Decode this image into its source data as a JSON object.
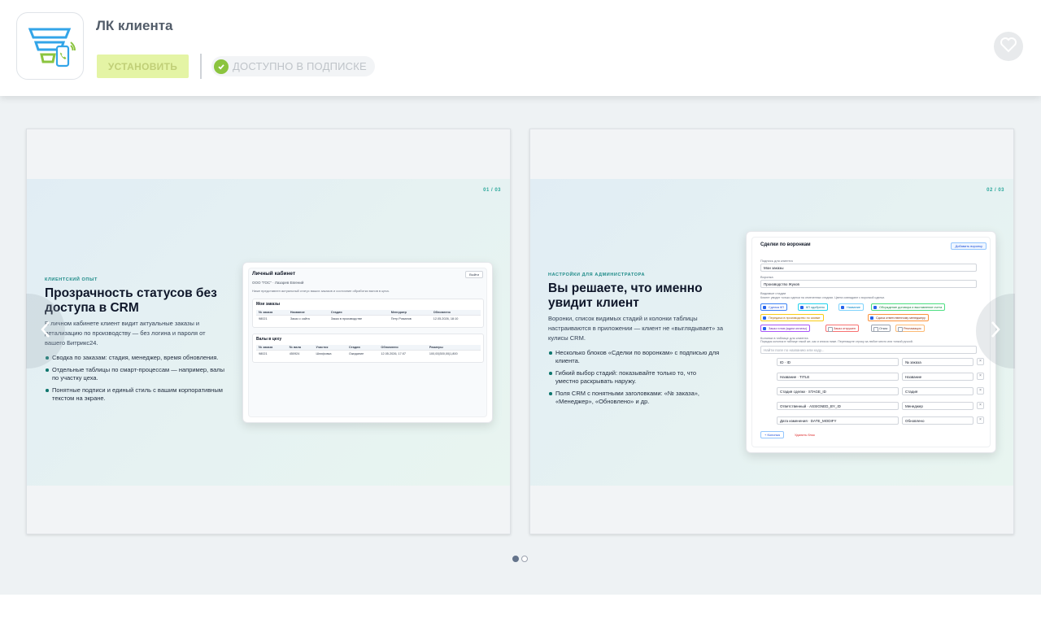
{
  "app": {
    "title": "ЛК клиента",
    "install_label": "УСТАНОВИТЬ",
    "subscription_label": "ДОСТУПНО В ПОДПИСКЕ",
    "logo_icon": "funnel-phone-icon",
    "favorite_icon": "heart-icon"
  },
  "colors": {
    "accent_green": "#8bc43f",
    "install_bg": "#e4f4a5",
    "teal": "#2aa79b"
  },
  "slides": [
    {
      "counter": "01 / 03",
      "eyebrow": "КЛИЕНТСКИЙ ОПЫТ",
      "heading_1": "Прозрачность статусов без",
      "heading_2": "доступа в CRM",
      "desc_1": "В личном кабинете клиент видит актуальные заказы и",
      "desc_2": "детализацию по производству — без логина и пароля от",
      "desc_3": "вашего Битрикс24.",
      "bullets": [
        "Сводка по заказам: стадия, менеджер, время обновления.",
        "Отдельные таблицы по смарт-процессам — например, валы по участку цеха.",
        "Понятные подписи и единый стиль с вашим корпоративным текстом на экране."
      ],
      "mock": {
        "title": "Личный кабинет",
        "exit": "Выйти",
        "company": "ООО \"ГОС\" · Лазарев Евгений",
        "note": "Ниже представлен актуальный статус ваших заказов и состояние обработки валов в цеха.",
        "orders_title": "Мои заказы",
        "orders_headers": [
          "№ заказа",
          "Название",
          "Стадия",
          "Менеджер",
          "Обновлено"
        ],
        "orders_rows": [
          [
            "98021",
            "Заказ с сайта",
            "Заказ в производстве",
            "Петр Романов",
            "12.05.2026, 18:10"
          ]
        ],
        "shafts_title": "Валы в цеху",
        "shafts_headers": [
          "№ заказа",
          "№ вала",
          "Участок",
          "Стадия",
          "Обновлено",
          "Размеры"
        ],
        "shafts_rows": [
          [
            "98021",
            "450924",
            "Шлифовка",
            "Ожидание",
            "12.05.2026, 17:07",
            "100,00|300,00|1,800"
          ]
        ]
      }
    },
    {
      "counter": "02 / 03",
      "eyebrow": "НАСТРОЙКИ ДЛЯ АДМИНИСТРАТОРА",
      "heading_1": "Вы решаете, что именно",
      "heading_2": "увидит клиент",
      "desc_1": "Воронки, список видимых стадий и колонки таблицы",
      "desc_2": "настраиваются в приложении — клиент не «выглядывает» за",
      "desc_3": "кулисы CRM.",
      "bullets": [
        "Несколько блоков «Сделки по воронкам» с подписью для клиента.",
        "Гибкий выбор стадий: показывайте только то, что уместно раскрывать наружу.",
        "Поля CRM с понятными заголовками: «№ заказа», «Менеджер», «Обновлено» и др."
      ],
      "mock": {
        "title": "Сделки по воронкам",
        "add_btn": "Добавить воронку",
        "caption_label": "Подпись для клиента",
        "caption_value": "Мои заказы",
        "funnel_label": "Воронка",
        "funnel_value": "Производство Жуков",
        "stages_label": "Видимые стадии",
        "stages_note": "Клиент увидит только сделки на отмеченных стадиях. Цвета совпадают с воронкой сделки.",
        "chips": [
          "Сделка КП",
          "КП одобрено",
          "Название",
          "Обсуждение договора и выставление счета",
          "Передача в производство по заявке",
          "Сдача ответственному менеджеру",
          "Заказ готов (ждем оплаты)",
          "Заказ отгружен",
          "Отказ",
          "Рекламация"
        ],
        "columns_label": "Колонки в таблице для клиента",
        "columns_note": "Порядок колонок в таблице такой же, как и список ниже. Перетащите строку за любое место или тонкой ручкой.",
        "search_placeholder": "Найти поле по названию или коду...",
        "rows": [
          [
            "ID · ID",
            "№ заказа"
          ],
          [
            "Название · TITLE",
            "Название"
          ],
          [
            "Стадия сделки · STAGE_ID",
            "Стадия"
          ],
          [
            "Ответственный · ASSIGNED_BY_ID",
            "Менеджер"
          ],
          [
            "Дата изменения · DATE_MODIFY",
            "Обновлено"
          ]
        ],
        "add_column": "+ Колонка",
        "delete_block": "Удалить блок"
      }
    }
  ],
  "nav": {
    "prev_icon": "chevron-left-icon",
    "next_icon": "chevron-right-icon"
  },
  "pagination": {
    "total": 2,
    "active": 1
  }
}
